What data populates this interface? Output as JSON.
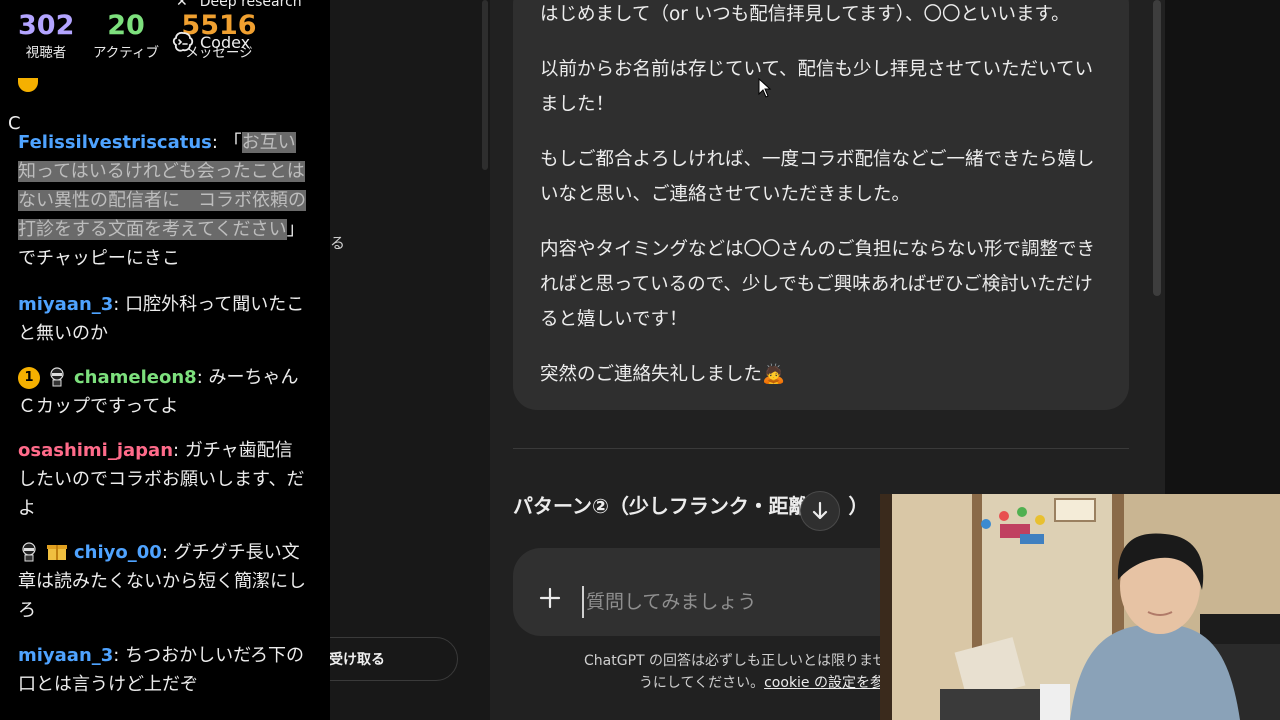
{
  "stream_stats": {
    "viewers": {
      "value": "302",
      "label": "視聴者"
    },
    "active": {
      "value": "20",
      "label": "アクティブ"
    },
    "messages": {
      "value": "5516",
      "label": "メッセージ"
    }
  },
  "sidebar": {
    "top_label": "Deep research",
    "codex_label": "Codex",
    "partial_text": "る",
    "receive_button_label": "受け取る"
  },
  "chat": {
    "top_partial": "C",
    "messages": [
      {
        "user": "Felissilvestriscatus",
        "user_color": "#4fa3ff",
        "sep": ":",
        "open_bracket": "「",
        "highlighted": "お互い知ってはいるけれども会ったことはない異性の配信者に　コラボ依頼の打診をする文面を考えてくださ",
        "highlighted_tail": "い",
        "text": "」でチャッピーにきこ"
      },
      {
        "user": "miyaan_3",
        "user_color": "#4fa3ff",
        "sep": ":",
        "text": " 口腔外科って聞いたこと無いのか"
      },
      {
        "user": "chameleon8",
        "user_color": "#7de07d",
        "sep": ":",
        "badge": "1",
        "text": " みーちゃんＣカップですってよ"
      },
      {
        "user": "osashimi_japan",
        "user_color": "#ff6b8a",
        "sep": ":",
        "text": " ガチャ歯配信したいのでコラボお願いします、だよ"
      },
      {
        "user": "chiyo_00",
        "user_color": "#4fa3ff",
        "sep": ":",
        "text": " グチグチ長い文章は読みたくないから短く簡潔にしろ"
      },
      {
        "user": "miyaan_3",
        "user_color": "#4fa3ff",
        "sep": ":",
        "text": " ちつおかしいだろ下の口とは言うけど上だぞ"
      }
    ]
  },
  "assistant_message": {
    "paragraphs": [
      "はじめまして（or いつも配信拝見してます）、〇〇といいます。",
      "以前からお名前は存じていて、配信も少し拝見させていただいていました！",
      "もしご都合よろしければ、一度コラボ配信などご一緒できたら嬉しいなと思い、ご連絡させていただきました。",
      "内容やタイミングなどは〇〇さんのご負担にならない形で調整できればと思っているので、少しでもご興味あればぜひご検討いただけると嬉しいです！",
      "突然のご連絡失礼しました🙇"
    ]
  },
  "pattern_heading": "パターン②（少しフランク・距離",
  "pattern_heading_tail": "）",
  "composer": {
    "placeholder": "質問してみましょう"
  },
  "disclaimer": {
    "line1": "ChatGPT の回答は必ずしも正しいとは限りません",
    "line2_prefix": "うにしてください。",
    "cookie_link": "cookie の設定を参"
  },
  "icons": {
    "plus": "plus-icon",
    "scroll_down": "arrow-down-icon",
    "codex": "codex-icon",
    "close": "close-icon"
  }
}
